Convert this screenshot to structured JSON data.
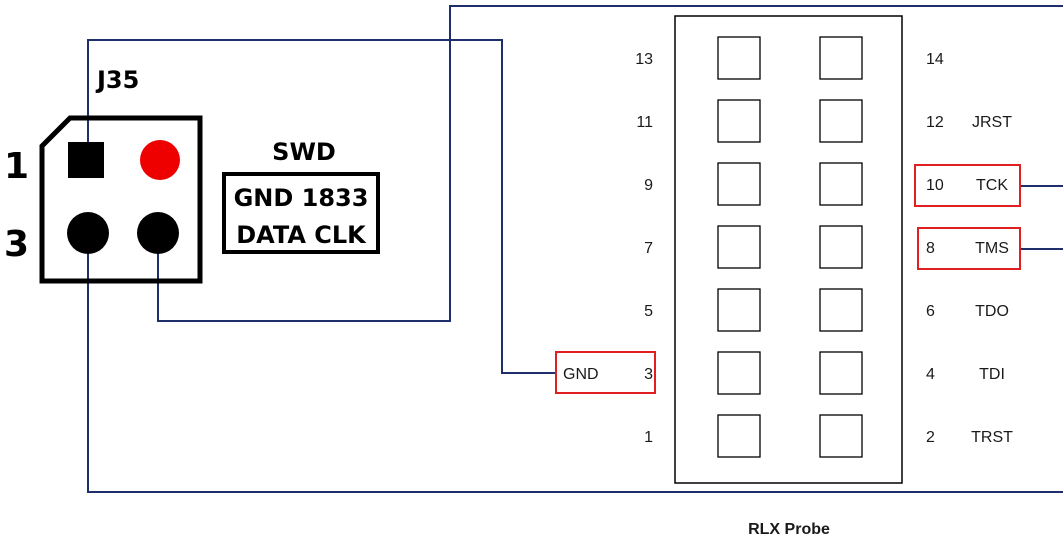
{
  "connector": {
    "name": "J35",
    "pin_label_1": "1",
    "pin_label_3": "3",
    "silkscreen_title": "SWD",
    "silkscreen_line1": "GND 1833",
    "silkscreen_line2": "DATA CLK"
  },
  "probe": {
    "title": "RLX Probe",
    "left_pins": [
      {
        "num": "13",
        "signal": ""
      },
      {
        "num": "11",
        "signal": ""
      },
      {
        "num": "9",
        "signal": ""
      },
      {
        "num": "7",
        "signal": ""
      },
      {
        "num": "5",
        "signal": ""
      },
      {
        "num": "3",
        "signal": "GND"
      },
      {
        "num": "1",
        "signal": ""
      }
    ],
    "right_pins": [
      {
        "num": "14",
        "signal": ""
      },
      {
        "num": "12",
        "signal": "JRST"
      },
      {
        "num": "10",
        "signal": "TCK"
      },
      {
        "num": "8",
        "signal": "TMS"
      },
      {
        "num": "6",
        "signal": "TDO"
      },
      {
        "num": "4",
        "signal": "TDI"
      },
      {
        "num": "2",
        "signal": "TRST"
      }
    ]
  },
  "colors": {
    "wire": "#1f2f6b",
    "highlight_box": "#e02020",
    "vcc_pin": "#ee0000",
    "pin": "#000000"
  }
}
